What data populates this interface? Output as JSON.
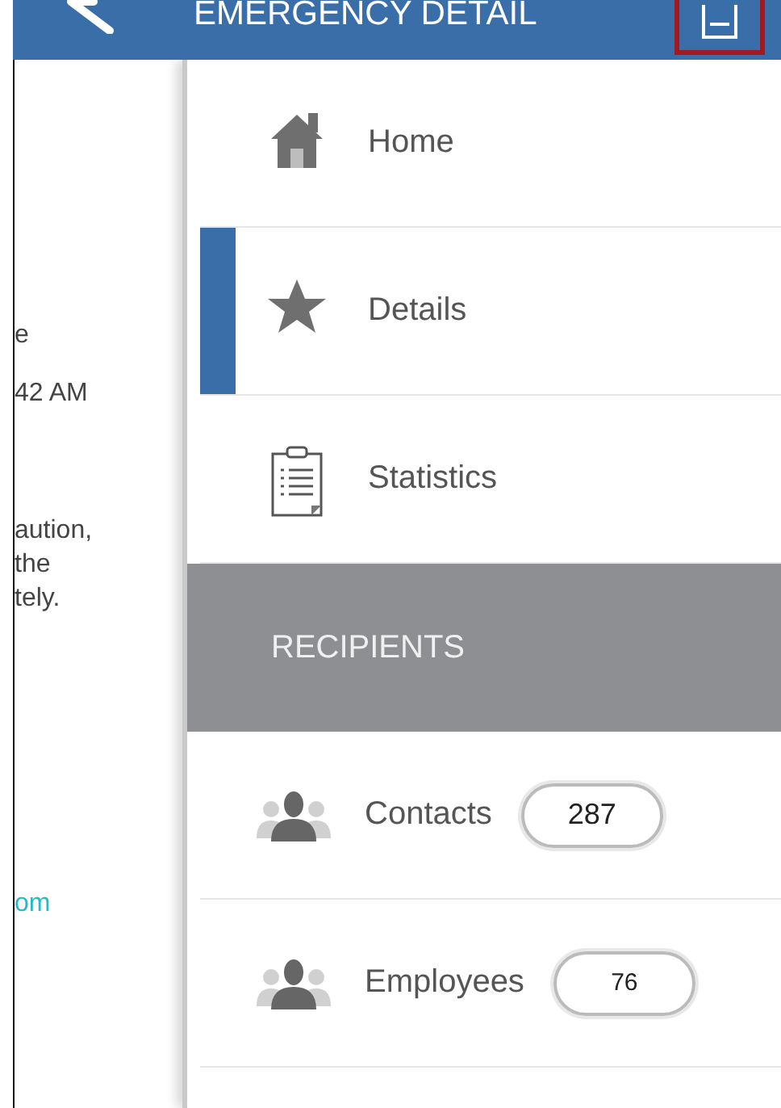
{
  "header": {
    "title": "EMERGENCY DETAIL"
  },
  "background_lines": [
    {
      "text": "e",
      "kind": "text"
    },
    {
      "text": "42 AM",
      "kind": "text"
    },
    {
      "text": "aution,\nthe\ntely.",
      "kind": "text"
    },
    {
      "text": "om",
      "kind": "link"
    }
  ],
  "menu": [
    {
      "kind": "nav",
      "label": "Home",
      "selected": false
    },
    {
      "kind": "nav",
      "label": "Details",
      "selected": true
    },
    {
      "kind": "nav",
      "label": "Statistics",
      "selected": false
    },
    {
      "kind": "section",
      "label": "RECIPIENTS"
    },
    {
      "kind": "group",
      "label": "Contacts",
      "count": "287"
    },
    {
      "kind": "group",
      "label": "Employees",
      "count": "76"
    }
  ]
}
